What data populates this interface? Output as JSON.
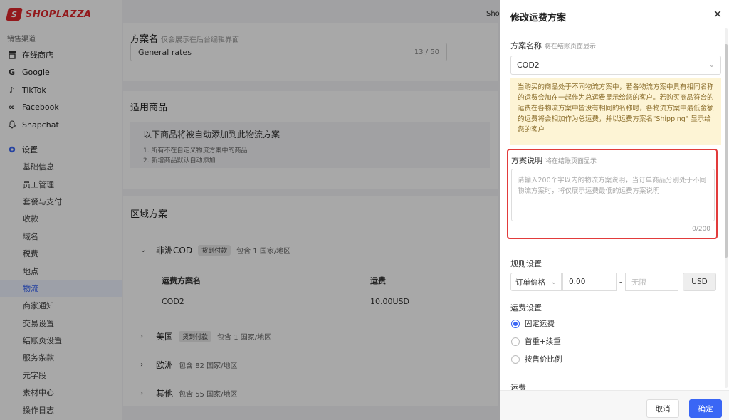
{
  "brand": {
    "logo_mark": "S",
    "name": "SHOPLAZZA"
  },
  "sidebar": {
    "section_label": "销售渠道",
    "channels": [
      {
        "label": "在线商店",
        "icon": "store-icon"
      },
      {
        "label": "Google",
        "icon": "google-icon"
      },
      {
        "label": "TikTok",
        "icon": "tiktok-icon"
      },
      {
        "label": "Facebook",
        "icon": "facebook-icon"
      },
      {
        "label": "Snapchat",
        "icon": "snapchat-icon"
      }
    ],
    "settings_label": "设置",
    "settings_items": [
      "基础信息",
      "员工管理",
      "套餐与支付",
      "收款",
      "域名",
      "税费",
      "地点",
      "物流",
      "商家通知",
      "交易设置",
      "结账页设置",
      "服务条款",
      "元字段",
      "素材中心",
      "操作日志"
    ],
    "active_item": "物流"
  },
  "topbar": {
    "shop_label": "Shop"
  },
  "main": {
    "plan_name_label": "方案名",
    "plan_name_hint": "仅会展示在后台编辑界面",
    "plan_name_value": "General rates",
    "plan_name_count": "13 / 50",
    "products_title": "适用商品",
    "products_tip_title": "以下商品将被自动添加到此物流方案",
    "products_tip_lines": [
      "1. 所有不在自定义物流方案中的商品",
      "2. 新增商品默认自动添加"
    ],
    "zones_title": "区域方案",
    "zones": [
      {
        "name": "非洲COD",
        "badge": "货到付款",
        "desc": "包含 1 国家/地区",
        "expanded": true
      },
      {
        "name": "美国",
        "badge": "货到付款",
        "desc": "包含 1 国家/地区",
        "expanded": false
      },
      {
        "name": "欧洲",
        "badge": "",
        "desc": "包含 82 国家/地区",
        "expanded": false
      },
      {
        "name": "其他",
        "badge": "",
        "desc": "包含 55 国家/地区",
        "expanded": false
      }
    ],
    "rate_table": {
      "headers": [
        "运费方案名",
        "运费"
      ],
      "rows": [
        [
          "COD2",
          "10.00USD"
        ]
      ]
    }
  },
  "drawer": {
    "title": "修改运费方案",
    "plan_name_label": "方案名称",
    "plan_name_hint": "将在结账页面显示",
    "plan_name_value": "COD2",
    "warning": "当购买的商品处于不同物流方案中，若各物流方案中具有相同名称的运费会加在一起作为总运费显示给您的客户。若购买商品符合的运费在各物流方案中皆没有相同的名称时，各物流方案中最低金额的运费将会相加作为总运费，并以运费方案名\"Shipping\" 显示给您的客户",
    "desc_label": "方案说明",
    "desc_hint": "将在结账页面显示",
    "desc_placeholder": "请输入200个字以内的物流方案说明，当订单商品分别处于不同物流方案时，将仅展示运费最低的运费方案说明",
    "desc_count": "0/200",
    "rules_label": "规则设置",
    "rule_type": "订单价格",
    "rule_min": "0.00",
    "rule_dash": "-",
    "rule_max_placeholder": "无限",
    "rule_unit": "USD",
    "fee_setting_label": "运费设置",
    "fee_options": [
      {
        "label": "固定运费",
        "selected": true
      },
      {
        "label": "首重+续重",
        "selected": false
      },
      {
        "label": "按售价比例",
        "selected": false
      }
    ],
    "fee_label": "运费",
    "cancel_label": "取消",
    "ok_label": "确定"
  },
  "colors": {
    "accent": "#3a66f5",
    "brand": "#e0262b",
    "highlight_border": "#e23b3b",
    "warning_bg": "#fdf4d5"
  }
}
